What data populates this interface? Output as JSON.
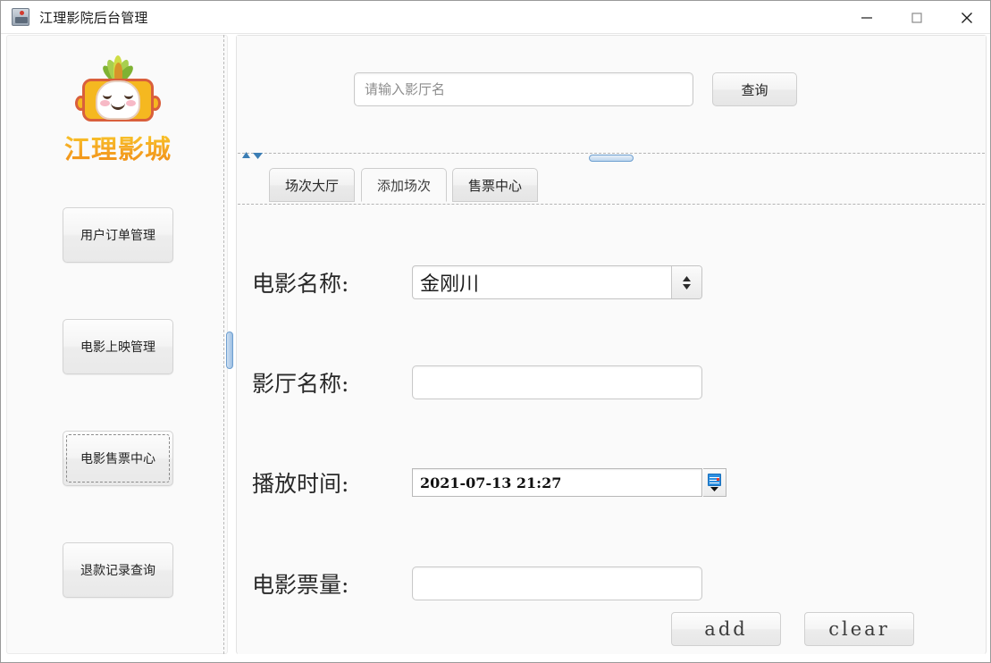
{
  "window": {
    "title": "江理影院后台管理",
    "icon": "app-icon",
    "controls": {
      "minimize": "minimize-icon",
      "maximize": "maximize-icon",
      "close": "close-icon"
    }
  },
  "sidebar": {
    "logo": {
      "mascot": "pineapple-mascot-icon",
      "text": "江理影城",
      "color": "#f4a81d"
    },
    "items": [
      {
        "label": "用户订单管理",
        "focused": false
      },
      {
        "label": "电影上映管理",
        "focused": false
      },
      {
        "label": "电影售票中心",
        "focused": true
      },
      {
        "label": "退款记录查询",
        "focused": false
      }
    ]
  },
  "search": {
    "placeholder": "请输入影厅名",
    "value": "",
    "button_label": "查询"
  },
  "tabs": [
    {
      "label": "场次大厅",
      "active": false
    },
    {
      "label": "添加场次",
      "active": true
    },
    {
      "label": "售票中心",
      "active": false
    }
  ],
  "form": {
    "movie_name": {
      "label": "电影名称:",
      "value": "金刚川",
      "control": "combobox"
    },
    "hall_name": {
      "label": "影厅名称:",
      "value": "",
      "control": "textfield"
    },
    "play_time": {
      "label": "播放时间:",
      "value": "2021-07-13 21:27",
      "control": "datetime",
      "icon": "calendar-icon"
    },
    "ticket_count": {
      "label": "电影票量:",
      "value": "",
      "control": "textfield"
    },
    "buttons": {
      "add": "add",
      "clear": "clear"
    }
  },
  "splitters": {
    "vertical": "vertical-split-handle",
    "horizontal": "horizontal-split-handle",
    "collapse_up": "collapse-up-arrow",
    "collapse_down": "collapse-down-arrow"
  }
}
